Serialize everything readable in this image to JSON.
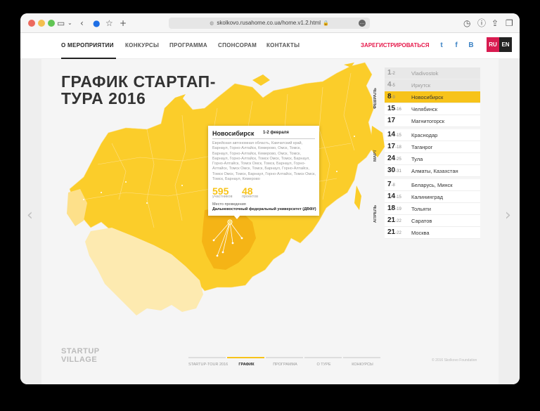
{
  "browser": {
    "url": "skolkovo.rusahome.co.ua/home.v1.2.html",
    "dots": [
      "#ec6a5e",
      "#f4bf4f",
      "#61c554"
    ]
  },
  "header": {
    "nav": [
      "О МЕРОПРИЯТИИ",
      "КОНКУРСЫ",
      "ПРОГРАММА",
      "СПОНСОРАМ",
      "КОНТАКТЫ"
    ],
    "register": "ЗАРЕГИСТРИРОВАТЬСЯ",
    "social": [
      "twitter-icon",
      "facebook-icon",
      "vk-icon"
    ],
    "social_glyphs": [
      "t",
      "f",
      "В"
    ],
    "langs": [
      "RU",
      "EN"
    ]
  },
  "page": {
    "title": "ГРАФИК СТАРТАП-ТУРА 2016",
    "arrow_left": "‹",
    "arrow_right": "›"
  },
  "popup": {
    "city": "Новосибирск",
    "date": "1-2 февраля",
    "regions": "Еврейская автономная область, Камчатский край, Барнаул, Горно-Алтайск, Кемерово, Омск, Томск, Барнаул, Горно-Алтайск, Кемерово, Омск, Томск, Барнаул, Горно-Алтайск, Томск Омск, Томск, Барнаул, Горно-Алтайск, Томск Омск, Томск, Барнаул, Горно-Алтайск, Томск Омск, Томск, Барнаул, Горно-Алтайск, Томск Омск, Томск, Барнаул, Горно-Алтайск, Томск Омск, Томск, Барнаул, Кемерово",
    "participants": "595",
    "participants_label": "участников",
    "projects": "48",
    "projects_label": "проектов",
    "venue_label": "Место проведения",
    "venue": "Дальневосточный федеральный университет (ДВФУ)"
  },
  "months": [
    "ФЕВРАЛЬ",
    "МАРТ",
    "АПРЕЛЬ"
  ],
  "schedule": [
    [
      {
        "day": "1",
        "sub": "-2",
        "city": "Vladivostok",
        "state": "past"
      },
      {
        "day": "4",
        "sub": "-5",
        "city": "Иркутск",
        "state": "past"
      },
      {
        "day": "8",
        "sub": "-9",
        "city": "Новосибирск",
        "state": "active"
      },
      {
        "day": "15",
        "sub": "-16",
        "city": "Челябинск",
        "state": ""
      },
      {
        "day": "17",
        "sub": "",
        "city": "Магнитогорск",
        "state": ""
      }
    ],
    [
      {
        "day": "14",
        "sub": "-15",
        "city": "Краснодар",
        "state": ""
      },
      {
        "day": "17",
        "sub": "-18",
        "city": "Таганрог",
        "state": ""
      },
      {
        "day": "24",
        "sub": "-25",
        "city": "Тула",
        "state": ""
      },
      {
        "day": "30",
        "sub": "-31",
        "city": "Алматы, Казахстан",
        "state": ""
      }
    ],
    [
      {
        "day": "7",
        "sub": "-8",
        "city": "Беларусь, Минск",
        "state": ""
      },
      {
        "day": "14",
        "sub": "-15",
        "city": "Калининград",
        "state": ""
      },
      {
        "day": "18",
        "sub": "-19",
        "city": "Тольяти",
        "state": ""
      },
      {
        "day": "21",
        "sub": "-22",
        "city": "Саратов",
        "state": ""
      },
      {
        "day": "21",
        "sub": "-22",
        "city": "Москва",
        "state": ""
      }
    ]
  ],
  "footer": {
    "logo_line1": "STARTUP",
    "logo_line2": "VILLAGE",
    "nav": [
      "STARTUP-TOUR 2016",
      "ГРАФИК",
      "ПРОГРАММА",
      "О ТУРЕ",
      "КОНКУРСЫ"
    ],
    "active_index": 1,
    "copyright": "© 2016 Skolkovo Foundation"
  },
  "colors": {
    "accent": "#f7c31a",
    "map_main": "#fbcd2a",
    "map_light": "#fde08a",
    "map_pale": "#fdeab0",
    "map_dark": "#f5b416",
    "register": "#e6194b",
    "lang_ru": "#d81b50",
    "lang_en": "#222222"
  }
}
